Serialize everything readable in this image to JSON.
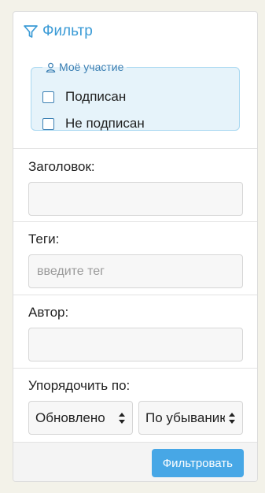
{
  "filter": {
    "title": "Фильтр",
    "icon": "filter-icon",
    "accent_color": "#3b9bd6"
  },
  "participation": {
    "legend": "Моё участие",
    "icon": "user-icon",
    "options": [
      {
        "label": "Подписан",
        "checked": false
      },
      {
        "label": "Не подписан",
        "checked": false
      }
    ]
  },
  "fields": {
    "title_label": "Заголовок:",
    "title_value": "",
    "tags_label": "Теги:",
    "tags_placeholder": "введите тег",
    "author_label": "Автор:",
    "author_value": "",
    "sort_label": "Упорядочить по:",
    "sort_field": "Обновлено",
    "sort_order": "По убыванию"
  },
  "actions": {
    "submit_label": "Фильтровать",
    "button_color": "#47a7e6"
  }
}
